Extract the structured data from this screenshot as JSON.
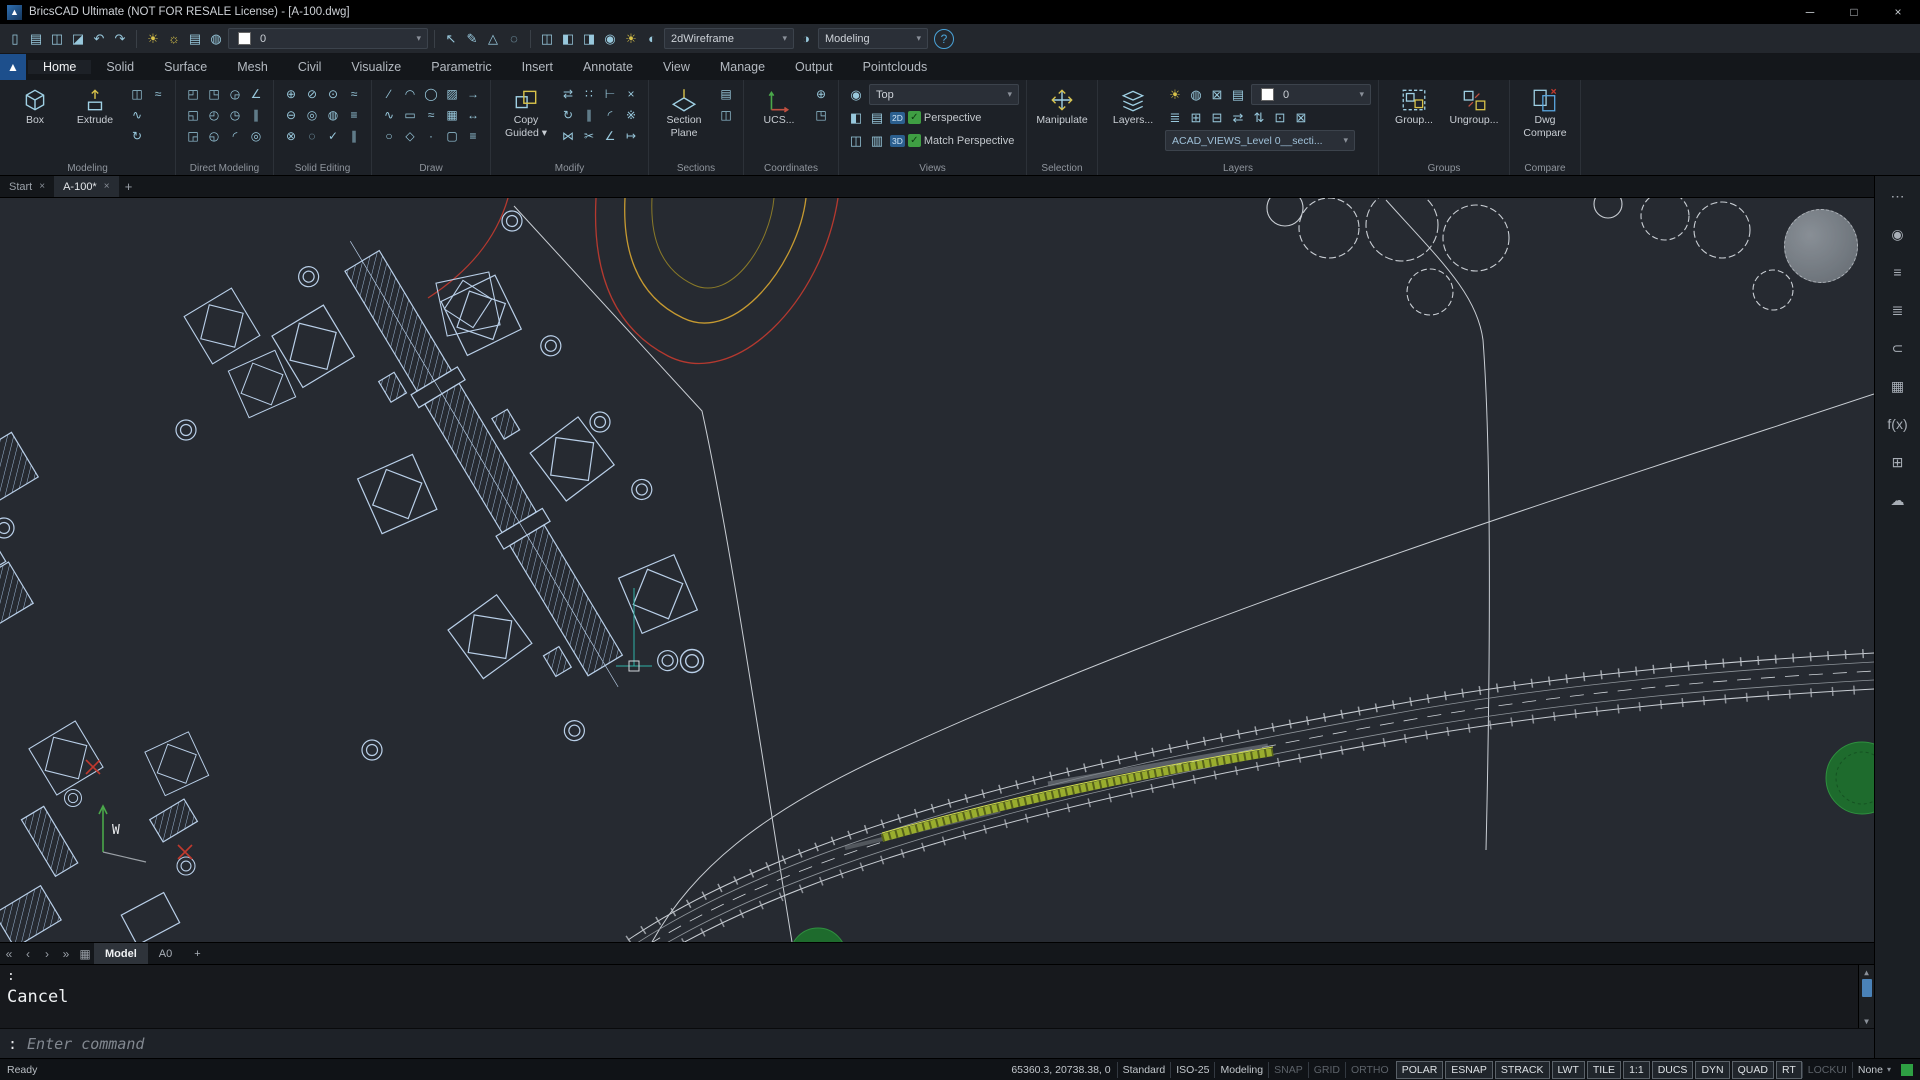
{
  "ui": {
    "caret": "▾"
  },
  "window": {
    "title": "BricsCAD Ultimate (NOT FOR RESALE License) - [A-100.dwg]",
    "minimize": "─",
    "maximize": "□",
    "close": "×",
    "logo": "▲"
  },
  "qat": {
    "icons_a": [
      {
        "n": "new-file-icon",
        "g": "▯"
      },
      {
        "n": "open-file-icon",
        "g": "▤"
      },
      {
        "n": "save-file-icon",
        "g": "◫"
      },
      {
        "n": "save-as-icon",
        "g": "◪"
      },
      {
        "n": "undo-icon",
        "g": "↶"
      },
      {
        "n": "redo-icon",
        "g": "↷"
      }
    ],
    "icons_b": [
      {
        "n": "layer-on-icon",
        "g": "☀",
        "c": "#d9c34a"
      },
      {
        "n": "sun-properties-icon",
        "g": "☼",
        "c": "#d9c34a"
      },
      {
        "n": "plot-style-icon",
        "g": "▤"
      },
      {
        "n": "freeze-layer-icon",
        "g": "◍"
      }
    ],
    "layer_value": "0",
    "icons_c": [
      {
        "n": "select-cursor-icon",
        "g": "↖"
      },
      {
        "n": "match-properties-icon",
        "g": "✎"
      },
      {
        "n": "annotative-scale-icon",
        "g": "△"
      },
      {
        "n": "purge-icon",
        "g": "◌"
      }
    ],
    "icons_d": [
      {
        "n": "view-top-icon",
        "g": "◫"
      },
      {
        "n": "view-iso-icon",
        "g": "◧"
      },
      {
        "n": "section-view-icon",
        "g": "◨"
      },
      {
        "n": "camera-icon",
        "g": "◉"
      },
      {
        "n": "light-icon",
        "g": "☀",
        "c": "#d9c34a"
      },
      {
        "n": "materials-icon",
        "g": "◐"
      }
    ],
    "visual_style_value": "2dWireframe",
    "icons_e": [
      {
        "n": "render-icon",
        "g": "◑"
      }
    ],
    "workspace_value": "Modeling",
    "help": "?"
  },
  "ribbon_tabs": {
    "items": [
      "Home",
      "Solid",
      "Surface",
      "Mesh",
      "Civil",
      "Visualize",
      "Parametric",
      "Insert",
      "Annotate",
      "View",
      "Manage",
      "Output",
      "Pointclouds"
    ],
    "active": "Home"
  },
  "ribbon": {
    "modeling": {
      "label": "Modeling",
      "box": "Box",
      "extrude": "Extrude",
      "minis": [
        {
          "n": "polysolid-icon",
          "g": "◫"
        },
        {
          "n": "sweep-icon",
          "g": "∿"
        },
        {
          "n": "revolve-icon",
          "g": "↻"
        },
        {
          "n": "loft-icon",
          "g": "≈"
        }
      ]
    },
    "direct_modeling": {
      "label": "Direct Modeling",
      "minis": [
        {
          "n": "dm-push-pull-icon",
          "g": "◰"
        },
        {
          "n": "dm-move-face-icon",
          "g": "◱"
        },
        {
          "n": "dm-rotate-face-icon",
          "g": "◲"
        },
        {
          "n": "dm-delete-face-icon",
          "g": "◳"
        },
        {
          "n": "dm-copy-face-icon",
          "g": "◴"
        },
        {
          "n": "dm-split-face-icon",
          "g": "◵"
        },
        {
          "n": "dm-taper-face-icon",
          "g": "◶"
        },
        {
          "n": "dm-extrude-face-icon",
          "g": "◷"
        },
        {
          "n": "dm-fillet-edge-icon",
          "g": "◜"
        },
        {
          "n": "dm-chamfer-edge-icon",
          "g": "∠"
        },
        {
          "n": "dm-offset-face-icon",
          "g": "∥"
        },
        {
          "n": "dm-shell-icon",
          "g": "◎"
        }
      ]
    },
    "solid_editing": {
      "label": "Solid Editing",
      "minis": [
        {
          "n": "union-icon",
          "g": "⊕"
        },
        {
          "n": "subtract-icon",
          "g": "⊖"
        },
        {
          "n": "intersect-icon",
          "g": "⊗"
        },
        {
          "n": "slice-icon",
          "g": "⊘"
        },
        {
          "n": "shell-icon",
          "g": "◎"
        },
        {
          "n": "separate-icon",
          "g": "◌"
        },
        {
          "n": "imprint-icon",
          "g": "⊙"
        },
        {
          "n": "clean-icon",
          "g": "◍"
        },
        {
          "n": "check-solid-icon",
          "g": "✓"
        },
        {
          "n": "stitch-icon",
          "g": "≈"
        },
        {
          "n": "thicken-icon",
          "g": "≡"
        },
        {
          "n": "offset-solid-icon",
          "g": "∥"
        }
      ]
    },
    "draw": {
      "label": "Draw",
      "minis": [
        {
          "n": "line-icon",
          "g": "∕"
        },
        {
          "n": "polyline-icon",
          "g": "∿"
        },
        {
          "n": "circle-icon",
          "g": "○"
        },
        {
          "n": "arc-icon",
          "g": "◠"
        },
        {
          "n": "rectangle-icon",
          "g": "▭"
        },
        {
          "n": "polygon-icon",
          "g": "◇"
        },
        {
          "n": "ellipse-icon",
          "g": "◯"
        },
        {
          "n": "spline-icon",
          "g": "≈"
        },
        {
          "n": "point-icon",
          "g": "·"
        },
        {
          "n": "hatch-icon",
          "g": "▨"
        },
        {
          "n": "region-icon",
          "g": "▦"
        },
        {
          "n": "boundary-icon",
          "g": "▢"
        },
        {
          "n": "ray-icon",
          "g": "→"
        },
        {
          "n": "construction-line-icon",
          "g": "↔"
        },
        {
          "n": "multiline-icon",
          "g": "≡"
        }
      ]
    },
    "modify": {
      "label": "Modify",
      "copy_line1": "Copy",
      "copy_line2": "Guided ▾",
      "minis": [
        {
          "n": "move-icon",
          "g": "⇄"
        },
        {
          "n": "rotate-icon",
          "g": "↻"
        },
        {
          "n": "mirror-icon",
          "g": "⋈"
        },
        {
          "n": "array-icon",
          "g": "∷"
        },
        {
          "n": "offset-icon",
          "g": "∥"
        },
        {
          "n": "trim-icon",
          "g": "✂"
        },
        {
          "n": "extend-icon",
          "g": "⊢"
        },
        {
          "n": "fillet-icon",
          "g": "◜"
        },
        {
          "n": "chamfer-icon",
          "g": "∠"
        },
        {
          "n": "erase-icon",
          "g": "×"
        },
        {
          "n": "explode-icon",
          "g": "※"
        },
        {
          "n": "stretch-icon",
          "g": "↦"
        }
      ]
    },
    "sections": {
      "label": "Sections",
      "btn_line1": "Section",
      "btn_line2": "Plane",
      "minis": [
        {
          "n": "section-detail-icon",
          "g": "▤"
        },
        {
          "n": "section-clip-icon",
          "g": "◫"
        }
      ]
    },
    "coordinates": {
      "label": "Coordinates",
      "btn": "UCS...",
      "minis": [
        {
          "n": "world-ucs-icon",
          "g": "⊕"
        },
        {
          "n": "ucs-face-icon",
          "g": "◳"
        }
      ]
    },
    "views": {
      "label": "Views",
      "eye_glyph": "◉",
      "view_value": "Top",
      "badge2d": "2D",
      "badge3d": "3D",
      "check_glyph": "✓",
      "perspective": "Perspective",
      "match_perspective": "Match Perspective",
      "row2": [
        {
          "n": "isolate-objects-icon",
          "g": "◧"
        },
        {
          "n": "hide-objects-icon",
          "g": "▤"
        }
      ],
      "row3": [
        {
          "n": "viewport-icon",
          "g": "◫"
        },
        {
          "n": "named-views-icon",
          "g": "▥"
        }
      ]
    },
    "selection": {
      "label": "Selection",
      "manipulate": "Manipulate"
    },
    "layers": {
      "label": "Layers",
      "layers_btn": "Layers...",
      "layer_value": "0",
      "views_layer_value": "ACAD_VIEWS_Level 0__secti...",
      "row1": [
        {
          "n": "layer-off-icon",
          "g": "☀",
          "c": "#d9c34a"
        },
        {
          "n": "layer-freeze-icon",
          "g": "◍"
        },
        {
          "n": "layer-lock-icon",
          "g": "⊠"
        },
        {
          "n": "layer-plot-icon",
          "g": "▤"
        }
      ],
      "row2": [
        {
          "n": "layer-states-icon",
          "g": "≣"
        },
        {
          "n": "layer-new-icon",
          "g": "⊞"
        },
        {
          "n": "layer-delete-icon",
          "g": "⊟"
        },
        {
          "n": "layer-match-icon",
          "g": "⇄"
        },
        {
          "n": "layer-walk-icon",
          "g": "⇅"
        },
        {
          "n": "layer-isolate-icon",
          "g": "⊡"
        },
        {
          "n": "layer-merge-icon",
          "g": "⊠"
        }
      ]
    },
    "groups": {
      "label": "Groups",
      "group": "Group...",
      "ungroup": "Ungroup..."
    },
    "compare": {
      "label": "Compare",
      "line1": "Dwg",
      "line2": "Compare"
    }
  },
  "doc_tabs": {
    "start": "Start",
    "active": "A-100*",
    "close": "×",
    "add": "+"
  },
  "canvas": {
    "ucs_label": "W"
  },
  "sidebar": {
    "items": [
      {
        "n": "more-options-icon",
        "g": "⋯"
      },
      {
        "n": "tips-icon",
        "g": "◉"
      },
      {
        "n": "settings-sliders-icon",
        "g": "≡"
      },
      {
        "n": "layers-panel-icon",
        "g": "≣"
      },
      {
        "n": "attachments-icon",
        "g": "⊂"
      },
      {
        "n": "hatch-patterns-icon",
        "g": "▦"
      },
      {
        "n": "fields-icon",
        "g": "f(x)"
      },
      {
        "n": "structure-panel-icon",
        "g": "⊞"
      },
      {
        "n": "cloud-upload-icon",
        "g": "☁"
      }
    ]
  },
  "layout_bar": {
    "nav": [
      {
        "n": "first-layout-icon",
        "g": "«"
      },
      {
        "n": "prev-layout-icon",
        "g": "‹"
      },
      {
        "n": "next-layout-icon",
        "g": "›"
      },
      {
        "n": "last-layout-icon",
        "g": "»"
      },
      {
        "n": "layout-list-icon",
        "g": "▦"
      }
    ],
    "model": "Model",
    "a0": "A0",
    "add": "+"
  },
  "command": {
    "history_1": ":",
    "history_2": "Cancel",
    "prompt": ":",
    "placeholder": "Enter command",
    "scroll_up": "▲",
    "scroll_down": "▼"
  },
  "status_bar": {
    "ready": "Ready",
    "coords": "65360.3, 20738.38, 0",
    "items": [
      {
        "label": "Standard",
        "state": "plain"
      },
      {
        "label": "ISO-25",
        "state": "plain"
      },
      {
        "label": "Modeling",
        "state": "plain"
      },
      {
        "label": "SNAP",
        "state": "off"
      },
      {
        "label": "GRID",
        "state": "off"
      },
      {
        "label": "ORTHO",
        "state": "off"
      },
      {
        "label": "POLAR",
        "state": "on"
      },
      {
        "label": "ESNAP",
        "state": "on"
      },
      {
        "label": "STRACK",
        "state": "on"
      },
      {
        "label": "LWT",
        "state": "on"
      },
      {
        "label": "TILE",
        "state": "on"
      },
      {
        "label": "1:1",
        "state": "on"
      },
      {
        "label": "DUCS",
        "state": "on"
      },
      {
        "label": "DYN",
        "state": "on"
      },
      {
        "label": "QUAD",
        "state": "on"
      },
      {
        "label": "RT",
        "state": "on"
      },
      {
        "label": "LOCKUI",
        "state": "off"
      },
      {
        "label": "None",
        "state": "dropdown"
      }
    ]
  },
  "colors": {
    "accent_blue": "#2f6fb2",
    "led_green": "#2ea043",
    "contour_red": "#b5392f",
    "contour_orange": "#c69a31",
    "road_green": "#99ad2e",
    "building_line": "#b9cfe8"
  }
}
